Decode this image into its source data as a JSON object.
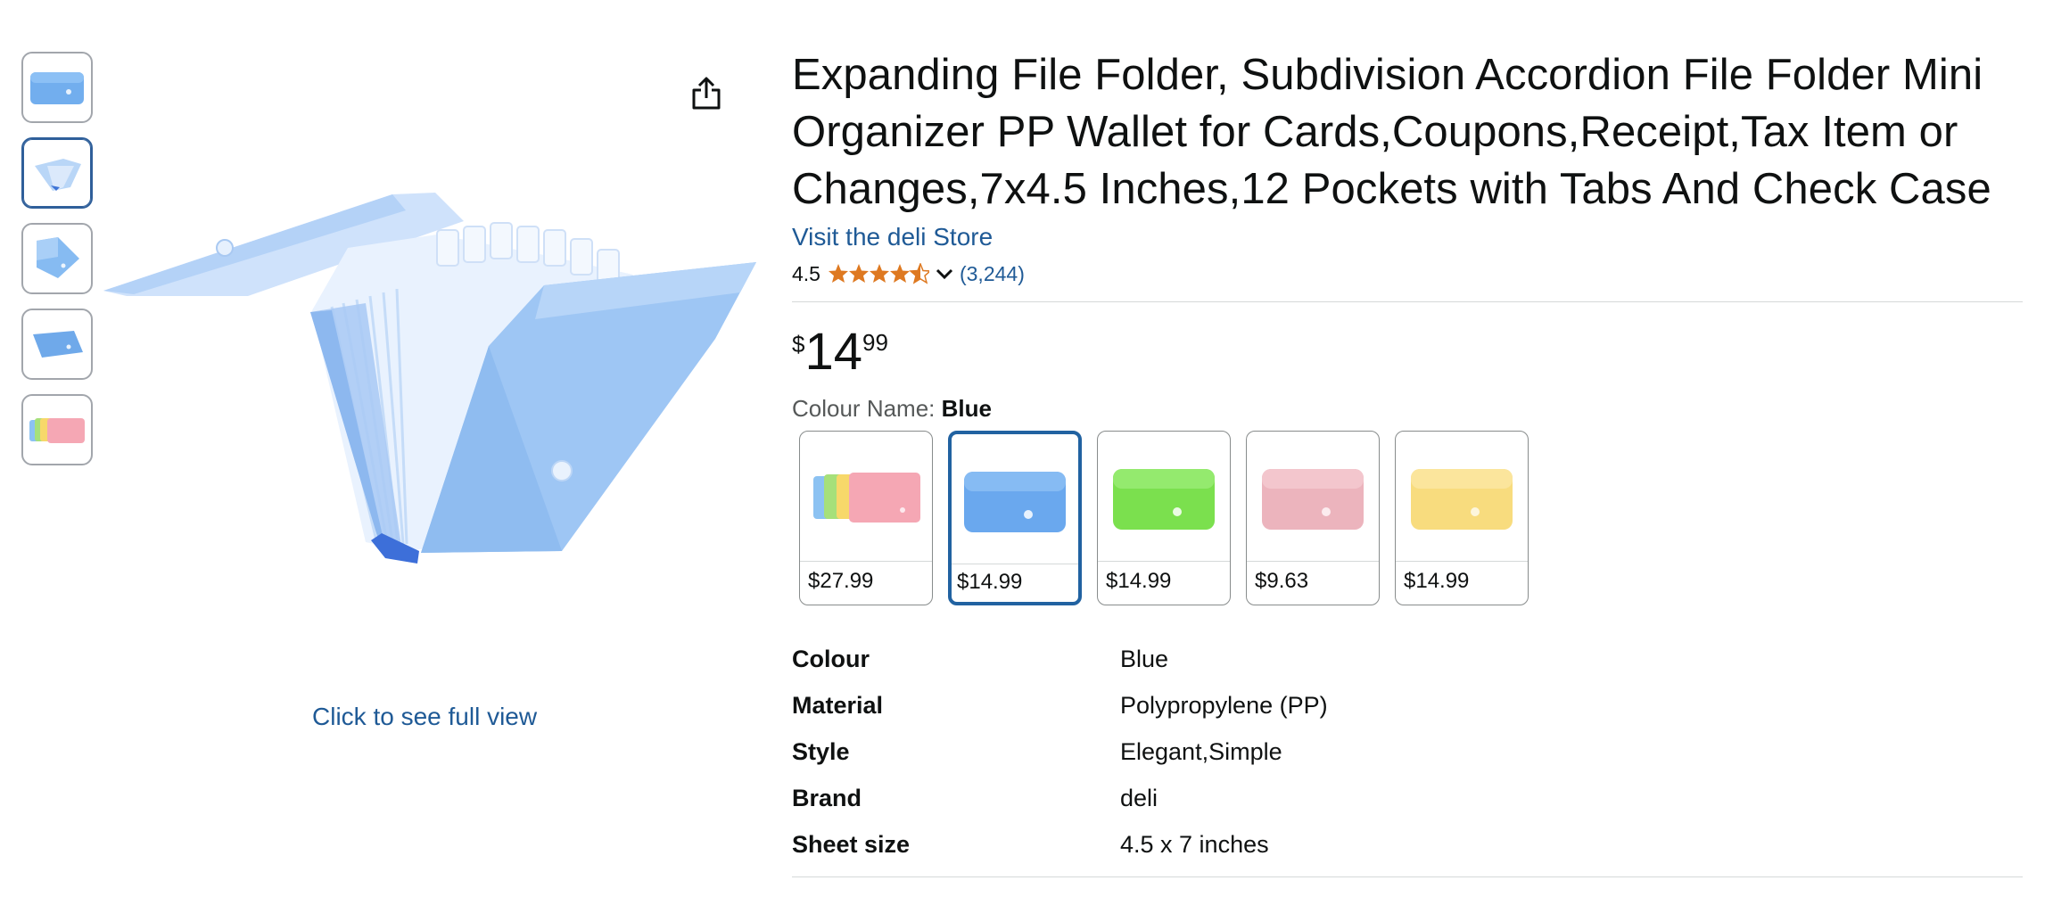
{
  "thumbnails": [
    {
      "name": "thumb-blue-folder"
    },
    {
      "name": "thumb-open-folder"
    },
    {
      "name": "thumb-folder-angle"
    },
    {
      "name": "thumb-folder-flat"
    },
    {
      "name": "thumb-multicolor"
    }
  ],
  "gallery": {
    "full_view_label": "Click to see full view",
    "share_icon": "share-icon"
  },
  "product": {
    "title": "Expanding File Folder, Subdivision Accordion File Folder Mini Organizer PP Wallet for Cards,Coupons,Receipt,Tax Item or Changes,7x4.5 Inches,12 Pockets with Tabs And Check Case",
    "store_link": "Visit the deli Store",
    "rating": "4.5",
    "rating_count": "(3,244)",
    "price": {
      "symbol": "$",
      "whole": "14",
      "fraction": "99"
    },
    "colour_label": "Colour Name:",
    "colour_value": "Blue",
    "swatches": [
      {
        "name": "Multicolor",
        "price": "$27.99"
      },
      {
        "name": "Blue",
        "price": "$14.99"
      },
      {
        "name": "Green",
        "price": "$14.99"
      },
      {
        "name": "Pink",
        "price": "$9.63"
      },
      {
        "name": "Yellow",
        "price": "$14.99"
      }
    ],
    "specs": [
      {
        "key": "Colour",
        "value": "Blue"
      },
      {
        "key": "Material",
        "value": "Polypropylene (PP)"
      },
      {
        "key": "Style",
        "value": "Elegant,Simple"
      },
      {
        "key": "Brand",
        "value": "deli"
      },
      {
        "key": "Sheet size",
        "value": "4.5 x 7 inches"
      }
    ]
  },
  "colors": {
    "link": "#1f5a96",
    "star": "#de7921",
    "selected_border": "#2162a1",
    "folder_blue": "#7fb7f0"
  }
}
